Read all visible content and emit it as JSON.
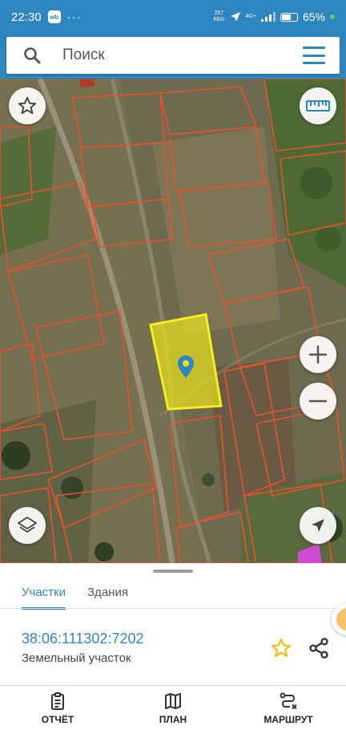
{
  "status_bar": {
    "time": "22:30",
    "app_badge": "wb",
    "overflow": "···",
    "net_speed_top": "257",
    "net_speed_bottom": "КБ/с",
    "net_type_top": "4G+",
    "net_type_bottom": "",
    "battery_percent": "65%",
    "battery_level": 0.65,
    "icons": [
      "location-arrow-icon",
      "signal-icon",
      "battery-icon"
    ]
  },
  "search": {
    "placeholder": "Поиск",
    "icon": "search-icon",
    "menu_icon": "menu-icon"
  },
  "map": {
    "selected_parcel_color": "#e6e01d",
    "parcel_border_color": "#e8522a",
    "controls": {
      "favorite": "star-outline-icon",
      "ruler": "ruler-icon",
      "zoom_in": "plus-icon",
      "zoom_out": "minus-icon",
      "layers": "layers-icon",
      "location": "navigation-arrow-icon",
      "marker": "map-pin-icon"
    }
  },
  "sheet": {
    "tabs": [
      {
        "label": "Участки",
        "active": true
      },
      {
        "label": "Здания",
        "active": false
      }
    ],
    "parcel": {
      "number": "38:06:111302:7202",
      "type": "Земельный участок"
    },
    "actions": [
      "star-icon",
      "share-icon"
    ]
  },
  "bottom_nav": {
    "items": [
      {
        "label": "ОТЧЁТ",
        "icon": "report-icon"
      },
      {
        "label": "ПЛАН",
        "icon": "map-plan-icon"
      },
      {
        "label": "МАРШРУТ",
        "icon": "route-icon"
      }
    ]
  },
  "colors": {
    "accent": "#2e86c1",
    "star": "#f2c21c"
  }
}
